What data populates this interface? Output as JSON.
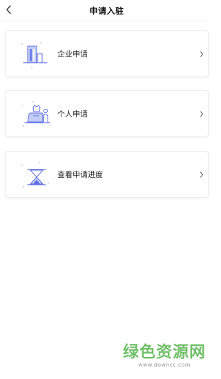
{
  "header": {
    "title": "申请入驻",
    "back_icon": "chevron-left-icon"
  },
  "cards": [
    {
      "label": "企业申请",
      "icon": "building-icon",
      "arrow_icon": "chevron-right-icon"
    },
    {
      "label": "个人申请",
      "icon": "person-icon",
      "arrow_icon": "chevron-right-icon"
    },
    {
      "label": "查看申请进度",
      "icon": "hourglass-icon",
      "arrow_icon": "chevron-right-icon"
    }
  ],
  "watermark": {
    "text": "绿色资源网",
    "url": "www.downcc.com"
  },
  "colors": {
    "icon_blue": "#5b6ee6",
    "icon_light": "#c3cdf6",
    "watermark_green": "#71c06a"
  }
}
